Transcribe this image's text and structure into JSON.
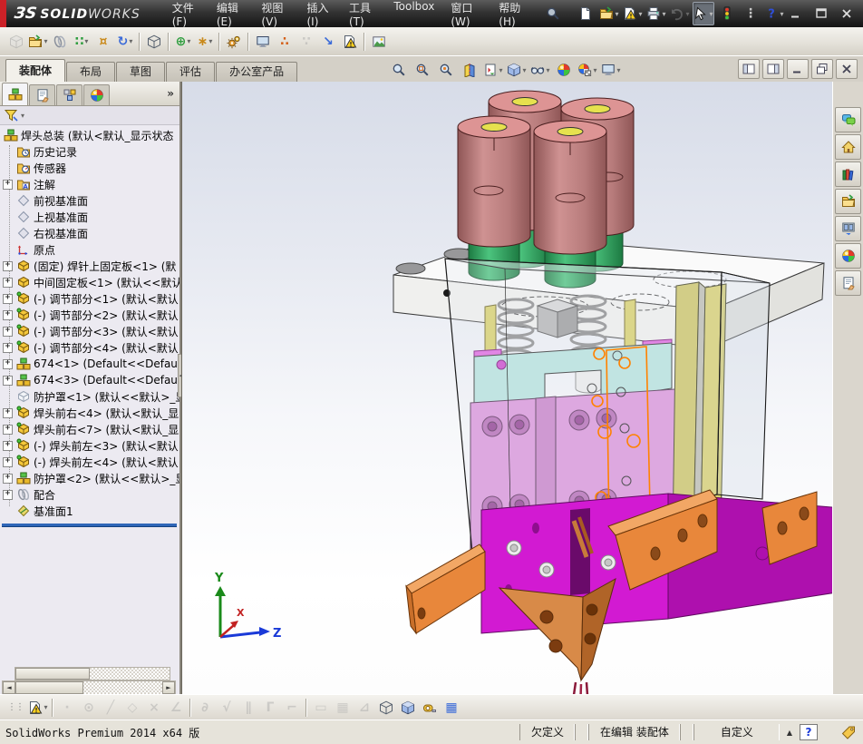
{
  "ui": {
    "dropdown": "▾",
    "chevron": "»",
    "plus": "+",
    "scroll_left": "◄",
    "scroll_right": "►",
    "drag_dots": "⋮⋮"
  },
  "palette": {
    "title_red": "#cc2127",
    "rollback_blue": "#2f66b8",
    "selection_orange": "#ff8200",
    "active_view_border": "#5a8ad8"
  },
  "title_bar": {
    "logo": {
      "mark": "ЗS",
      "bold": "SOLID",
      "light": "WORKS"
    },
    "menus": [
      "文件(F)",
      "编辑(E)",
      "视图(V)",
      "插入(I)",
      "工具(T)",
      "Toolbox",
      "窗口(W)",
      "帮助(H)"
    ],
    "quick_icons": [
      {
        "name": "new-document-button",
        "icon": "page"
      },
      {
        "name": "open-document-button",
        "icon": "folder-open",
        "dropdown": true
      },
      {
        "name": "solidworks-resources-button",
        "icon": "warning-page",
        "dropdown": true
      },
      {
        "name": "print-button",
        "icon": "printer",
        "dropdown": true
      },
      {
        "name": "undo-button",
        "icon": "undo",
        "dropdown": true,
        "disabled": true
      },
      {
        "name": "select-tool-button",
        "icon": "cursor",
        "dropdown": true,
        "pressed": true
      },
      {
        "name": "options-button",
        "icon": "traffic"
      },
      {
        "name": "command-finder-button",
        "glyph": "⋮",
        "color": "#c8c8c8"
      },
      {
        "name": "help-button",
        "icon": "help",
        "dropdown": true
      }
    ],
    "window_buttons": [
      {
        "name": "minimize-button",
        "icon": "min-l"
      },
      {
        "name": "maximize-button",
        "icon": "max-l"
      },
      {
        "name": "close-button",
        "icon": "close-l"
      }
    ]
  },
  "assembly_toolbar": {
    "icons": [
      {
        "name": "edit-component-button",
        "icon": "cube-gray",
        "disabled": true
      },
      {
        "name": "insert-components-button",
        "icon": "folder-open",
        "dropdown": true
      },
      {
        "name": "mate-button",
        "icon": "paperclip"
      },
      {
        "name": "linear-component-pattern-button",
        "glyph": "∷",
        "color": "#2f9e3f",
        "dropdown": true
      },
      {
        "name": "smart-fasteners-button",
        "glyph": "¤",
        "color": "#c9891a"
      },
      {
        "name": "move-component-button",
        "glyph": "↻",
        "color": "#3a6ad8",
        "dropdown": true
      },
      {
        "sep": true
      },
      {
        "name": "show-hidden-components-button",
        "icon": "cube-wire"
      },
      {
        "sep": true
      },
      {
        "name": "assembly-features-button",
        "glyph": "⊕",
        "color": "#2f9e3f",
        "dropdown": true
      },
      {
        "name": "reference-geometry-button",
        "glyph": "∗",
        "color": "#c9891a",
        "dropdown": true
      },
      {
        "sep": true
      },
      {
        "name": "motion-study-button",
        "icon": "gears"
      },
      {
        "sep": true
      },
      {
        "name": "bill-of-materials-button",
        "icon": "monitor"
      },
      {
        "name": "exploded-view-button",
        "glyph": "∴",
        "color": "#d4601a"
      },
      {
        "name": "explode-line-sketch-button",
        "glyph": "∵",
        "color": "#9aa0a8",
        "disabled": true
      },
      {
        "name": "interference-detection-button",
        "glyph": "↘",
        "color": "#3a6ad8"
      },
      {
        "name": "assembly-xpert-button",
        "icon": "warning-page"
      },
      {
        "sep": true
      },
      {
        "name": "take-snapshot-button",
        "icon": "picture"
      }
    ]
  },
  "command_manager": {
    "tabs": [
      {
        "label": "装配体",
        "active": true
      },
      {
        "label": "布局"
      },
      {
        "label": "草图"
      },
      {
        "label": "评估"
      },
      {
        "label": "办公室产品"
      }
    ]
  },
  "view_toolbar": {
    "icons": [
      {
        "name": "zoom-to-fit-button",
        "icon": "magnifier"
      },
      {
        "name": "zoom-to-area-button",
        "icon": "magnifier-area"
      },
      {
        "name": "magnified-selection-button",
        "icon": "magnifier-sel"
      },
      {
        "name": "section-view-button",
        "icon": "section"
      },
      {
        "name": "view-orientation-button",
        "icon": "page-arrows",
        "dropdown": true
      },
      {
        "name": "display-style-button",
        "icon": "cube",
        "dropdown": true
      },
      {
        "name": "hide-show-items-button",
        "icon": "glasses",
        "dropdown": true
      },
      {
        "name": "apply-scene-button",
        "icon": "ball"
      },
      {
        "name": "view-settings-button",
        "icon": "ball-check",
        "dropdown": true
      },
      {
        "name": "full-screen-preview-button",
        "icon": "monitor",
        "dropdown": true
      }
    ]
  },
  "doc_window_buttons": [
    {
      "name": "collapse-left-pane-button",
      "icon": "pane1"
    },
    {
      "name": "collapse-right-pane-button",
      "icon": "pane2"
    },
    {
      "name": "doc-minimize-button",
      "icon": "min-d"
    },
    {
      "name": "doc-restore-button",
      "icon": "restore-d"
    },
    {
      "name": "doc-close-button",
      "icon": "close-d"
    }
  ],
  "feature_panel": {
    "tabs": [
      {
        "name": "featuremanager-tab",
        "icon": "t-asm",
        "active": true
      },
      {
        "name": "propertymanager-tab",
        "icon": "hand-form"
      },
      {
        "name": "configurationmanager-tab",
        "icon": "config-blocks"
      },
      {
        "name": "displaymanager-tab",
        "icon": "ball"
      }
    ],
    "tree": [
      {
        "icon": "t-asm",
        "label": "焊头总装 (默认<默认_显示状态",
        "depth": 0
      },
      {
        "icon": "t-hist",
        "label": "历史记录",
        "depth": 1
      },
      {
        "icon": "t-sensor",
        "label": "传感器",
        "depth": 1
      },
      {
        "icon": "t-ann",
        "label": "注解",
        "depth": 1,
        "plus": true
      },
      {
        "icon": "t-plane",
        "label": "前视基准面",
        "depth": 1
      },
      {
        "icon": "t-plane",
        "label": "上视基准面",
        "depth": 1
      },
      {
        "icon": "t-plane",
        "label": "右视基准面",
        "depth": 1
      },
      {
        "icon": "t-origin",
        "label": "原点",
        "depth": 1
      },
      {
        "icon": "t-part",
        "label": "(固定) 焊针上固定板<1> (默",
        "depth": 1,
        "plus": true
      },
      {
        "icon": "t-part",
        "label": "中间固定板<1> (默认<<默认",
        "depth": 1,
        "plus": true
      },
      {
        "icon": "t-partg",
        "label": "(-) 调节部分<1> (默认<默认",
        "depth": 1,
        "plus": true
      },
      {
        "icon": "t-partg",
        "label": "(-) 调节部分<2> (默认<默认",
        "depth": 1,
        "plus": true
      },
      {
        "icon": "t-partg",
        "label": "(-) 调节部分<3> (默认<默认",
        "depth": 1,
        "plus": true
      },
      {
        "icon": "t-partg",
        "label": "(-) 调节部分<4> (默认<默认",
        "depth": 1,
        "plus": true
      },
      {
        "icon": "t-asm",
        "label": "674<1> (Default<<Default>_",
        "depth": 1,
        "plus": true
      },
      {
        "icon": "t-asm",
        "label": "674<3> (Default<<Default>_",
        "depth": 1,
        "plus": true
      },
      {
        "icon": "t-parth",
        "label": "防护罩<1> (默认<<默认>_显",
        "depth": 1
      },
      {
        "icon": "t-partg",
        "label": "焊头前右<4> (默认<默认_显",
        "depth": 1,
        "plus": true
      },
      {
        "icon": "t-partg",
        "label": "焊头前右<7> (默认<默认_显",
        "depth": 1,
        "plus": true
      },
      {
        "icon": "t-partg",
        "label": "(-) 焊头前左<3> (默认<默认",
        "depth": 1,
        "plus": true
      },
      {
        "icon": "t-partg",
        "label": "(-) 焊头前左<4> (默认<默认",
        "depth": 1,
        "plus": true
      },
      {
        "icon": "t-asm",
        "label": "防护罩<2> (默认<<默认>_显",
        "depth": 1,
        "plus": true
      },
      {
        "icon": "t-clip",
        "label": "配合",
        "depth": 1,
        "plus": true
      },
      {
        "icon": "t-planeg",
        "label": "基准面1",
        "depth": 1
      }
    ]
  },
  "viewport": {
    "triad": {
      "x": "X",
      "y": "Y",
      "z": "Z"
    },
    "model_colors": {
      "cylinder_salmon": "#c08484",
      "cap_yellow": "#e6e14e",
      "base_green": "#2fa35e",
      "plate_white": "#fafafa",
      "block_cyan": "#b6e3de",
      "plate_orchid": "#db93db",
      "slab_yellow": "#cdc567",
      "block_magenta": "#d21ad2",
      "bracket_orange": "#e8873b",
      "electrode_copper": "#cc7c3c",
      "selection_outline": "#ff8200"
    }
  },
  "task_pane": {
    "tabs": [
      {
        "name": "comments-tab",
        "icon": "chat"
      },
      {
        "name": "home-tab",
        "icon": "house"
      },
      {
        "name": "design-library-tab",
        "icon": "books"
      },
      {
        "name": "file-explorer-tab",
        "icon": "folder-open"
      },
      {
        "name": "view-pal-tab",
        "icon": "view-palette"
      },
      {
        "name": "appearances-tab",
        "icon": "ball"
      },
      {
        "name": "custom-properties-tab",
        "icon": "hand-form"
      }
    ]
  },
  "sketch_toolbar": {
    "icons": [
      {
        "name": "quick-tips-button",
        "icon": "warning-page",
        "dropdown": true
      },
      {
        "sep": true
      },
      {
        "name": "sketch-point-button",
        "glyph": "·",
        "color": "#9aa0a8",
        "disabled": true
      },
      {
        "name": "sketch-circle-button",
        "glyph": "⊙",
        "color": "#9aa0a8",
        "disabled": true
      },
      {
        "name": "sketch-line-button",
        "glyph": "╱",
        "color": "#9aa0a8",
        "disabled": true
      },
      {
        "name": "sketch-polygon-button",
        "glyph": "◇",
        "color": "#9aa0a8",
        "disabled": true
      },
      {
        "name": "sketch-trim-button",
        "glyph": "×",
        "color": "#9aa0a8",
        "disabled": true
      },
      {
        "name": "sketch-angle-button",
        "glyph": "∠",
        "color": "#9aa0a8",
        "disabled": true
      },
      {
        "sep": true
      },
      {
        "name": "relation-tangent-button",
        "glyph": "∂",
        "color": "#9aa0a8",
        "disabled": true
      },
      {
        "name": "relation-coincident-button",
        "glyph": "√",
        "color": "#9aa0a8",
        "disabled": true
      },
      {
        "name": "relation-parallel-button",
        "glyph": "∥",
        "color": "#9aa0a8",
        "disabled": true
      },
      {
        "name": "relation-perpendicular-button",
        "glyph": "Γ",
        "color": "#9aa0a8",
        "disabled": true
      },
      {
        "name": "relation-fix-button",
        "glyph": "⌐",
        "color": "#9aa0a8",
        "disabled": true
      },
      {
        "sep": true
      },
      {
        "name": "instant2d-button",
        "glyph": "▭",
        "color": "#9aa0a8",
        "disabled": true
      },
      {
        "name": "grid-snap-button",
        "glyph": "▦",
        "color": "#9aa0a8",
        "disabled": true
      },
      {
        "name": "angle-snap-button",
        "glyph": "⊿",
        "color": "#9aa0a8",
        "disabled": true
      },
      {
        "name": "wireframe-view-button",
        "icon": "cube-wire"
      },
      {
        "name": "shaded-view-button",
        "icon": "cube",
        "pressed": true
      },
      {
        "name": "measure-button",
        "icon": "measure"
      },
      {
        "name": "design-table-button",
        "glyph": "▦",
        "color": "#3a6ad8"
      }
    ]
  },
  "status_bar": {
    "left": "SolidWorks Premium 2014 x64 版",
    "cells": {
      "definition": "欠定义",
      "editing": "在编辑 装配体",
      "custom": "自定义"
    },
    "custom_arrow": "▲",
    "help_glyph": "?"
  }
}
